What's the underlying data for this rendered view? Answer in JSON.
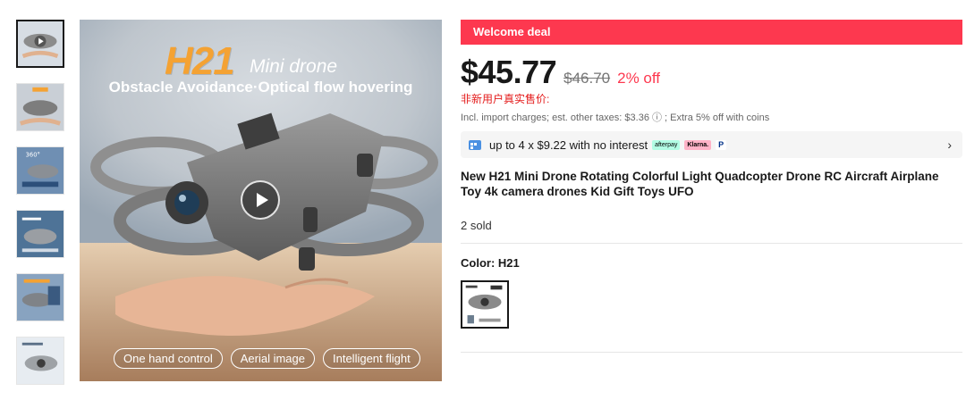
{
  "thumbnails": [
    {
      "name": "thumb-1"
    },
    {
      "name": "thumb-2"
    },
    {
      "name": "thumb-3"
    },
    {
      "name": "thumb-4"
    },
    {
      "name": "thumb-5"
    },
    {
      "name": "thumb-6"
    }
  ],
  "main_image": {
    "brand": "H21",
    "brand_sub": "Mini drone",
    "tagline": "Obstacle Avoidance·Optical flow hovering",
    "features": [
      "One hand control",
      "Aerial image",
      "Intelligent flight"
    ]
  },
  "deal": {
    "label": "Welcome deal"
  },
  "price": {
    "current": "$45.77",
    "original": "$46.70",
    "discount": "2% off",
    "note_cn": "非新用户真实售价:",
    "tax_note": "Incl. import charges; est. other taxes: $3.36 ⓘ ; Extra 5% off with coins"
  },
  "installments": {
    "text": "up to 4 x $9.22 with no interest",
    "providers": [
      "afterpay",
      "Klarna.",
      "P"
    ]
  },
  "product": {
    "title": "New H21 Mini Drone Rotating Colorful Light Quadcopter Drone RC Aircraft Airplane Toy 4k camera drones Kid Gift Toys UFO",
    "sold": "2 sold"
  },
  "color": {
    "label": "Color: H21"
  },
  "colors": {
    "accent": "#fd384f",
    "brand_orange": "#f4a233"
  }
}
